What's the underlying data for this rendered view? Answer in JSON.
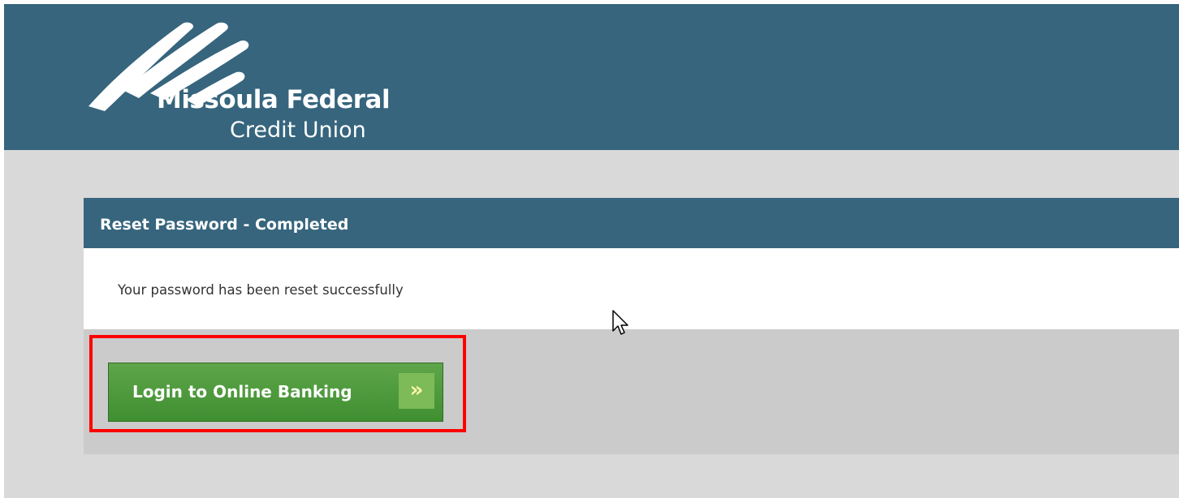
{
  "brand": {
    "name": "Missoula Federal",
    "subtitle": "Credit Union"
  },
  "panel": {
    "title": "Reset Password - Completed",
    "message": "Your password has been reset successfully"
  },
  "login_button": {
    "label": "Login to Online Banking",
    "arrow": "»"
  },
  "colors": {
    "header": "#36657d",
    "page_background": "#d9d9d9",
    "button_green": "#4a9a3a",
    "highlight": "#ff0000"
  }
}
